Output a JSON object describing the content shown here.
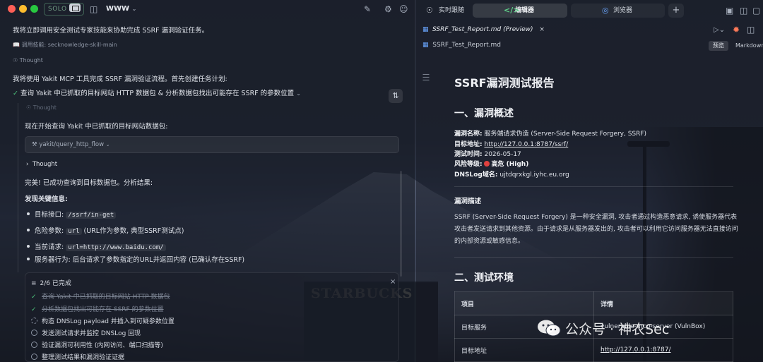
{
  "topbar": {
    "solo_label": "SOLO",
    "workspace": "WWW"
  },
  "left": {
    "intro": "我将立即调用安全测试专家技能来协助完成 SSRF 漏洞验证任务。",
    "skill_call": "调用技能: secknowledge-skill-main",
    "thought_1": "Thought",
    "plan_intro": "我将使用 Yakit MCP 工具完成 SSRF 漏洞验证流程。首先创建任务计划:",
    "step_title": "查询 Yakit 中已抓取的目标网站 HTTP 数据包 & 分析数据包找出可能存在 SSRF 的参数位置",
    "thought_2": "Thought",
    "query_intro": "现在开始查询 Yakit 中已抓取的目标网站数据包:",
    "tool_name": "yakit/query_http_flow",
    "thought_3": "Thought",
    "result_intro": "完美! 已成功查询到目标数据包。分析结果:",
    "findings_title": "发现关键信息:",
    "findings": [
      {
        "label": "目标接口:",
        "code": "/ssrf/in-get",
        "note": ""
      },
      {
        "label": "危险参数:",
        "code": "url",
        "note": "(URL作为参数, 典型SSRF测试点)"
      },
      {
        "label": "当前请求:",
        "code": "url=http://www.baidu.com/",
        "note": ""
      },
      {
        "label": "服务器行为: 后台请求了参数指定的URL并返回内容 (已确认存在SSRF)",
        "code": "",
        "note": ""
      }
    ],
    "todo": {
      "progress": "2/6 已完成",
      "items": [
        {
          "text": "查询 Yakit 中已抓取的目标网站 HTTP 数据包",
          "state": "done"
        },
        {
          "text": "分析数据包找出可能存在 SSRF 的参数位置",
          "state": "done"
        },
        {
          "text": "构造 DNSLog payload 并插入到可疑参数位置",
          "state": "active"
        },
        {
          "text": "发送测试请求并监控 DNSLog 回现",
          "state": "pending"
        },
        {
          "text": "验证漏洞可利用性 (内网访问、端口扫描等)",
          "state": "pending"
        },
        {
          "text": "整理测试结果和漏洞验证证据",
          "state": "pending"
        }
      ]
    }
  },
  "right": {
    "tabs": [
      {
        "label": "实时跟随",
        "icon": "target-icon"
      },
      {
        "label": "编辑器",
        "icon": "code-icon"
      },
      {
        "label": "浏览器",
        "icon": "compass-icon"
      }
    ],
    "file_tab": "SSRF_Test_Report.md (Preview)",
    "breadcrumb": "SSRF_Test_Report.md",
    "preview_label": "预览",
    "markdown_label": "Markdown",
    "report": {
      "title": "SSRF漏洞测试报告",
      "section1": "一、漏洞概述",
      "kv": [
        {
          "key": "漏洞名称:",
          "value": "服务端请求伪造 (Server-Side Request Forgery, SSRF)"
        },
        {
          "key": "目标地址:",
          "value": "http://127.0.0.1:8787/ssrf/"
        },
        {
          "key": "测试时间:",
          "value": "2026-05-17"
        },
        {
          "key": "风险等级:",
          "value": "高危 (High)"
        },
        {
          "key": "DNSLog域名:",
          "value": "ujtdqrxkgl.iyhc.eu.org"
        }
      ],
      "desc_title": "漏洞描述",
      "desc": "SSRF (Server-Side Request Forgery) 是一种安全漏洞, 攻击者通过构造恶意请求, 诱使服务器代表攻击者发送请求到其他资源。由于请求是从服务器发出的, 攻击者可以利用它访问服务器无法直接访问的内部资源或敏感信息。",
      "section2": "二、测试环境",
      "table_headers": [
        "项目",
        "详情"
      ],
      "table_rows": [
        {
          "item": "目标服务",
          "detail": "vulnerable-mcp-server (VulnBox)"
        },
        {
          "item": "目标地址",
          "detail": "http://127.0.0.1:8787/"
        }
      ]
    }
  },
  "watermark": "公众号 · 神农Sec",
  "colors": {
    "accent_green": "#4cc07a",
    "risk_red": "#e0413f"
  }
}
